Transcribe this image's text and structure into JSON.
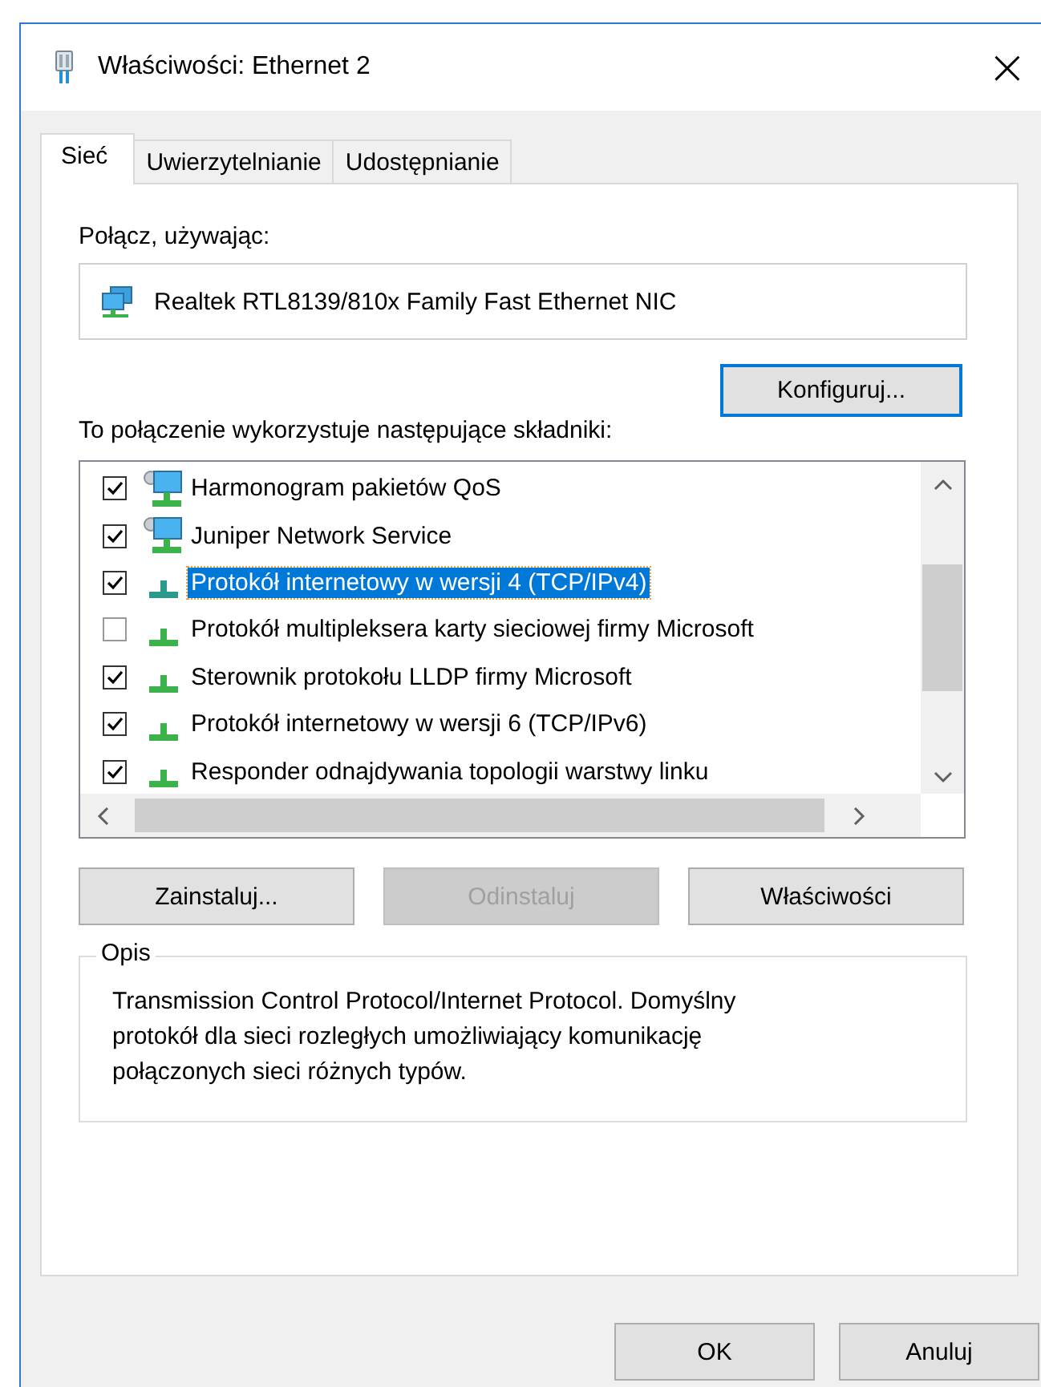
{
  "window": {
    "title": "Właściwości: Ethernet 2",
    "close": "×"
  },
  "tabs": [
    {
      "label": "Sieć",
      "selected": true
    },
    {
      "label": "Uwierzytelnianie",
      "selected": false
    },
    {
      "label": "Udostępnianie",
      "selected": false
    }
  ],
  "connect_using": {
    "label": "Połącz, używając:",
    "adapter": "Realtek RTL8139/810x Family Fast Ethernet NIC"
  },
  "configure_button": {
    "label": "Konfiguruj...",
    "focused": true
  },
  "components": {
    "label": "To połączenie wykorzystuje następujące składniki:",
    "items": [
      {
        "kind": "service",
        "name": "Harmonogram pakietów QoS",
        "checked": true,
        "selected": false
      },
      {
        "kind": "service",
        "name": "Juniper Network Service",
        "checked": true,
        "selected": false
      },
      {
        "kind": "protocol",
        "name": "Protokół internetowy w wersji 4 (TCP/IPv4)",
        "checked": true,
        "selected": true
      },
      {
        "kind": "protocol",
        "name": "Protokół multipleksera karty sieciowej firmy Microsoft",
        "checked": false,
        "selected": false
      },
      {
        "kind": "protocol",
        "name": "Sterownik protokołu LLDP firmy Microsoft",
        "checked": true,
        "selected": false
      },
      {
        "kind": "protocol",
        "name": "Protokół internetowy w wersji 6 (TCP/IPv6)",
        "checked": true,
        "selected": false
      },
      {
        "kind": "protocol",
        "name": "Responder odnajdywania topologii warstwy linku",
        "checked": true,
        "selected": false
      }
    ]
  },
  "action_buttons": [
    {
      "label": "Zainstaluj...",
      "disabled": false
    },
    {
      "label": "Odinstaluj",
      "disabled": true
    },
    {
      "label": "Właściwości",
      "disabled": false
    }
  ],
  "description": {
    "title": "Opis",
    "text": "Transmission Control Protocol/Internet Protocol. Domyślny protokół dla sieci rozległych umożliwiający komunikację połączonych sieci różnych typów."
  },
  "footer_buttons": [
    {
      "label": "OK"
    },
    {
      "label": "Anuluj"
    }
  ]
}
